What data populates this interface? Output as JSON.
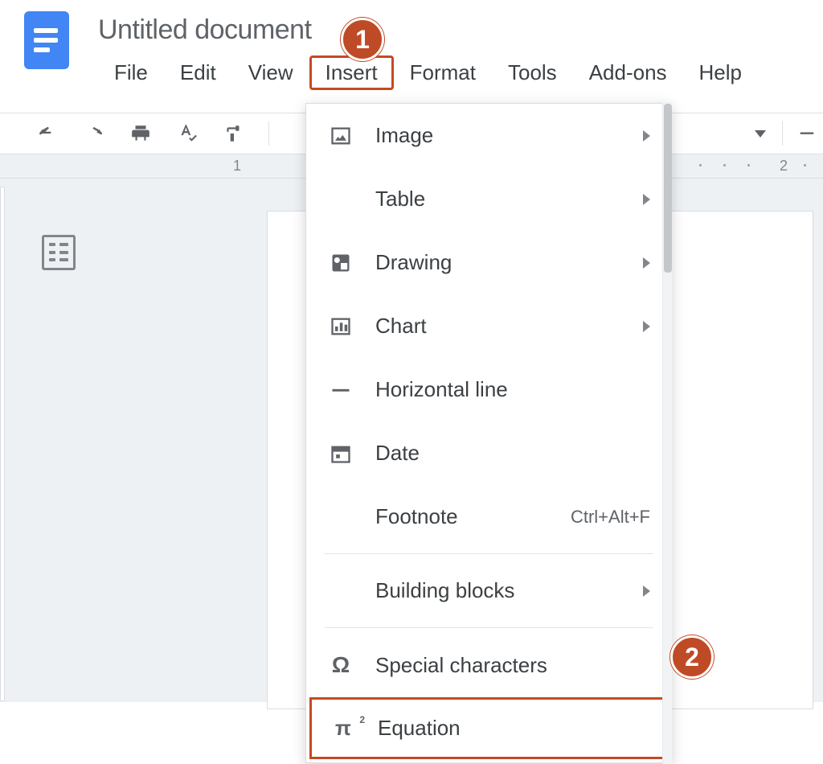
{
  "title": "Untitled document",
  "menus": {
    "file": "File",
    "edit": "Edit",
    "view": "View",
    "insert": "Insert",
    "format": "Format",
    "tools": "Tools",
    "addons": "Add-ons",
    "help": "Help"
  },
  "ruler": {
    "l1": "1",
    "l2": "2"
  },
  "dropdown": {
    "image": "Image",
    "table": "Table",
    "drawing": "Drawing",
    "chart": "Chart",
    "hr": "Horizontal line",
    "date": "Date",
    "footnote": "Footnote",
    "footnote_short": "Ctrl+Alt+F",
    "blocks": "Building blocks",
    "special": "Special characters",
    "equation": "Equation"
  },
  "callouts": {
    "one": "1",
    "two": "2"
  }
}
